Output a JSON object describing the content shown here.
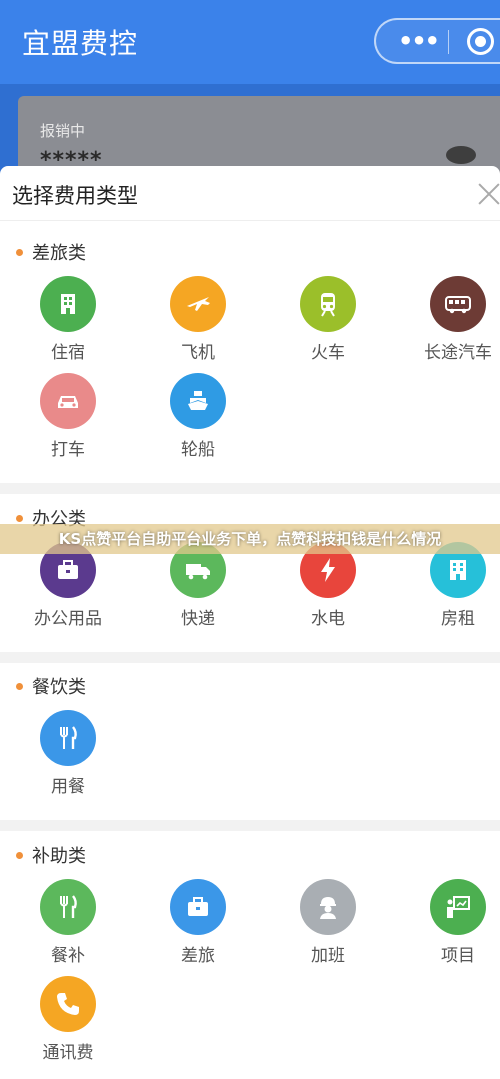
{
  "app": {
    "title": "宜盟费控"
  },
  "capsule": {
    "more_icon": "more-dots-icon",
    "target_icon": "record-target-icon"
  },
  "background_card": {
    "label": "报销中",
    "masked_value": "*****"
  },
  "sheet": {
    "title": "选择费用类型",
    "close_icon": "close-icon"
  },
  "sections": [
    {
      "title": "差旅类",
      "items": [
        {
          "label": "住宿",
          "icon": "building-icon",
          "color": "#4caf50"
        },
        {
          "label": "飞机",
          "icon": "airplane-icon",
          "color": "#f5a623"
        },
        {
          "label": "火车",
          "icon": "train-icon",
          "color": "#9bbf2a"
        },
        {
          "label": "长途汽车",
          "icon": "bus-icon",
          "color": "#6d3b35"
        },
        {
          "label": "打车",
          "icon": "taxi-icon",
          "color": "#e98a8a"
        },
        {
          "label": "轮船",
          "icon": "ship-icon",
          "color": "#2f9be4"
        }
      ]
    },
    {
      "title": "办公类",
      "items": [
        {
          "label": "办公用品",
          "icon": "briefcase-icon",
          "color": "#5b3a8e"
        },
        {
          "label": "快递",
          "icon": "truck-icon",
          "color": "#5cb85c"
        },
        {
          "label": "水电",
          "icon": "lightning-icon",
          "color": "#e8453c"
        },
        {
          "label": "房租",
          "icon": "apartment-icon",
          "color": "#26c0d9"
        }
      ]
    },
    {
      "title": "餐饮类",
      "items": [
        {
          "label": "用餐",
          "icon": "fork-knife-icon",
          "color": "#3b97e8"
        }
      ]
    },
    {
      "title": "补助类",
      "items": [
        {
          "label": "餐补",
          "icon": "fork-knife-icon",
          "color": "#5cb85c"
        },
        {
          "label": "差旅",
          "icon": "briefcase-icon",
          "color": "#3b97e8"
        },
        {
          "label": "加班",
          "icon": "worker-icon",
          "color": "#a9aeb3"
        },
        {
          "label": "项目",
          "icon": "presentation-icon",
          "color": "#4caf50"
        },
        {
          "label": "通讯费",
          "icon": "phone-icon",
          "color": "#f5a623"
        }
      ]
    }
  ],
  "overlay_banner": {
    "text": "KS点赞平台自助平台业务下单，点赞科技扣钱是什么情况"
  }
}
